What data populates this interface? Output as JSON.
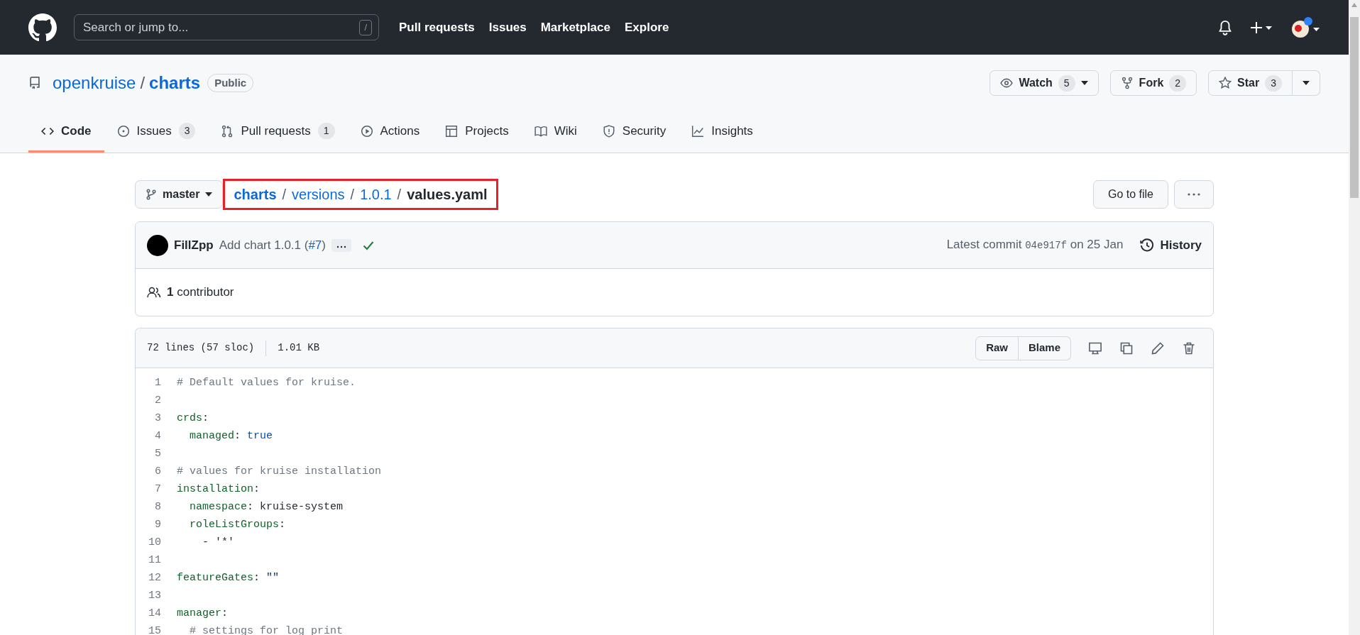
{
  "header": {
    "search_placeholder": "Search or jump to...",
    "search_key": "/",
    "nav": [
      "Pull requests",
      "Issues",
      "Marketplace",
      "Explore"
    ]
  },
  "repo": {
    "owner": "openkruise",
    "separator": "/",
    "name": "charts",
    "visibility": "Public",
    "actions": [
      {
        "kind": "watch",
        "label": "Watch",
        "count": "5",
        "dropdown": true
      },
      {
        "kind": "fork",
        "label": "Fork",
        "count": "2",
        "dropdown": false
      },
      {
        "kind": "star",
        "label": "Star",
        "count": "3",
        "dropdown": true
      }
    ]
  },
  "tabs": [
    {
      "kind": "code",
      "label": "Code",
      "selected": true
    },
    {
      "kind": "issues",
      "label": "Issues",
      "count": "3",
      "selected": false
    },
    {
      "kind": "pulls",
      "label": "Pull requests",
      "count": "1",
      "selected": false
    },
    {
      "kind": "actions",
      "label": "Actions",
      "selected": false
    },
    {
      "kind": "projects",
      "label": "Projects",
      "selected": false
    },
    {
      "kind": "wiki",
      "label": "Wiki",
      "selected": false
    },
    {
      "kind": "security",
      "label": "Security",
      "selected": false
    },
    {
      "kind": "insights",
      "label": "Insights",
      "selected": false
    }
  ],
  "file_nav": {
    "branch": "master",
    "highlighted": true,
    "breadcrumb": [
      {
        "kind": "link",
        "text": "charts"
      },
      {
        "kind": "separator",
        "text": "/"
      },
      {
        "kind": "link",
        "text": "versions"
      },
      {
        "kind": "separator",
        "text": "/"
      },
      {
        "kind": "link",
        "text": "1.0.1"
      },
      {
        "kind": "separator",
        "text": "/"
      },
      {
        "kind": "current",
        "text": "values.yaml"
      }
    ],
    "go_to_file": "Go to file"
  },
  "commit": {
    "author": "FillZpp",
    "message_before": "Add chart 1.0.1 (",
    "pr": "#7",
    "message_after": ")",
    "checks_passed": true,
    "latest_label": "Latest commit",
    "sha": "04e917f",
    "date": "on 25 Jan",
    "history": "History"
  },
  "contributors": {
    "count": "1",
    "label": "contributor"
  },
  "file": {
    "lines_info": "72 lines (57 sloc)",
    "size": "1.01 KB",
    "view_buttons": [
      "Raw",
      "Blame"
    ],
    "lines": [
      {
        "number": "1",
        "tokens": [
          {
            "kind": "comment",
            "text": "# Default values for kruise."
          }
        ]
      },
      {
        "number": "2"
      },
      {
        "number": "3",
        "tokens": [
          {
            "kind": "key",
            "text": "crds"
          },
          {
            "kind": "plain",
            "text": ":"
          }
        ]
      },
      {
        "number": "4",
        "tokens": [
          {
            "kind": "key",
            "text": "  managed"
          },
          {
            "kind": "plain",
            "text": ": "
          },
          {
            "kind": "bool",
            "text": "true"
          }
        ]
      },
      {
        "number": "5"
      },
      {
        "number": "6",
        "tokens": [
          {
            "kind": "comment",
            "text": "# values for kruise installation"
          }
        ]
      },
      {
        "number": "7",
        "tokens": [
          {
            "kind": "key",
            "text": "installation"
          },
          {
            "kind": "plain",
            "text": ":"
          }
        ]
      },
      {
        "number": "8",
        "tokens": [
          {
            "kind": "key",
            "text": "  namespace"
          },
          {
            "kind": "plain",
            "text": ": kruise-system"
          }
        ]
      },
      {
        "number": "9",
        "tokens": [
          {
            "kind": "key",
            "text": "  roleListGroups"
          },
          {
            "kind": "plain",
            "text": ":"
          }
        ]
      },
      {
        "number": "10",
        "tokens": [
          {
            "kind": "plain",
            "text": "    - '*'"
          }
        ]
      },
      {
        "number": "11"
      },
      {
        "number": "12",
        "tokens": [
          {
            "kind": "key",
            "text": "featureGates"
          },
          {
            "kind": "plain",
            "text": ": "
          },
          {
            "kind": "string",
            "text": "\"\""
          }
        ]
      },
      {
        "number": "13"
      },
      {
        "number": "14",
        "tokens": [
          {
            "kind": "key",
            "text": "manager"
          },
          {
            "kind": "plain",
            "text": ":"
          }
        ]
      },
      {
        "number": "15",
        "tokens": [
          {
            "kind": "comment",
            "text": "  # settings for log print"
          }
        ]
      }
    ]
  }
}
